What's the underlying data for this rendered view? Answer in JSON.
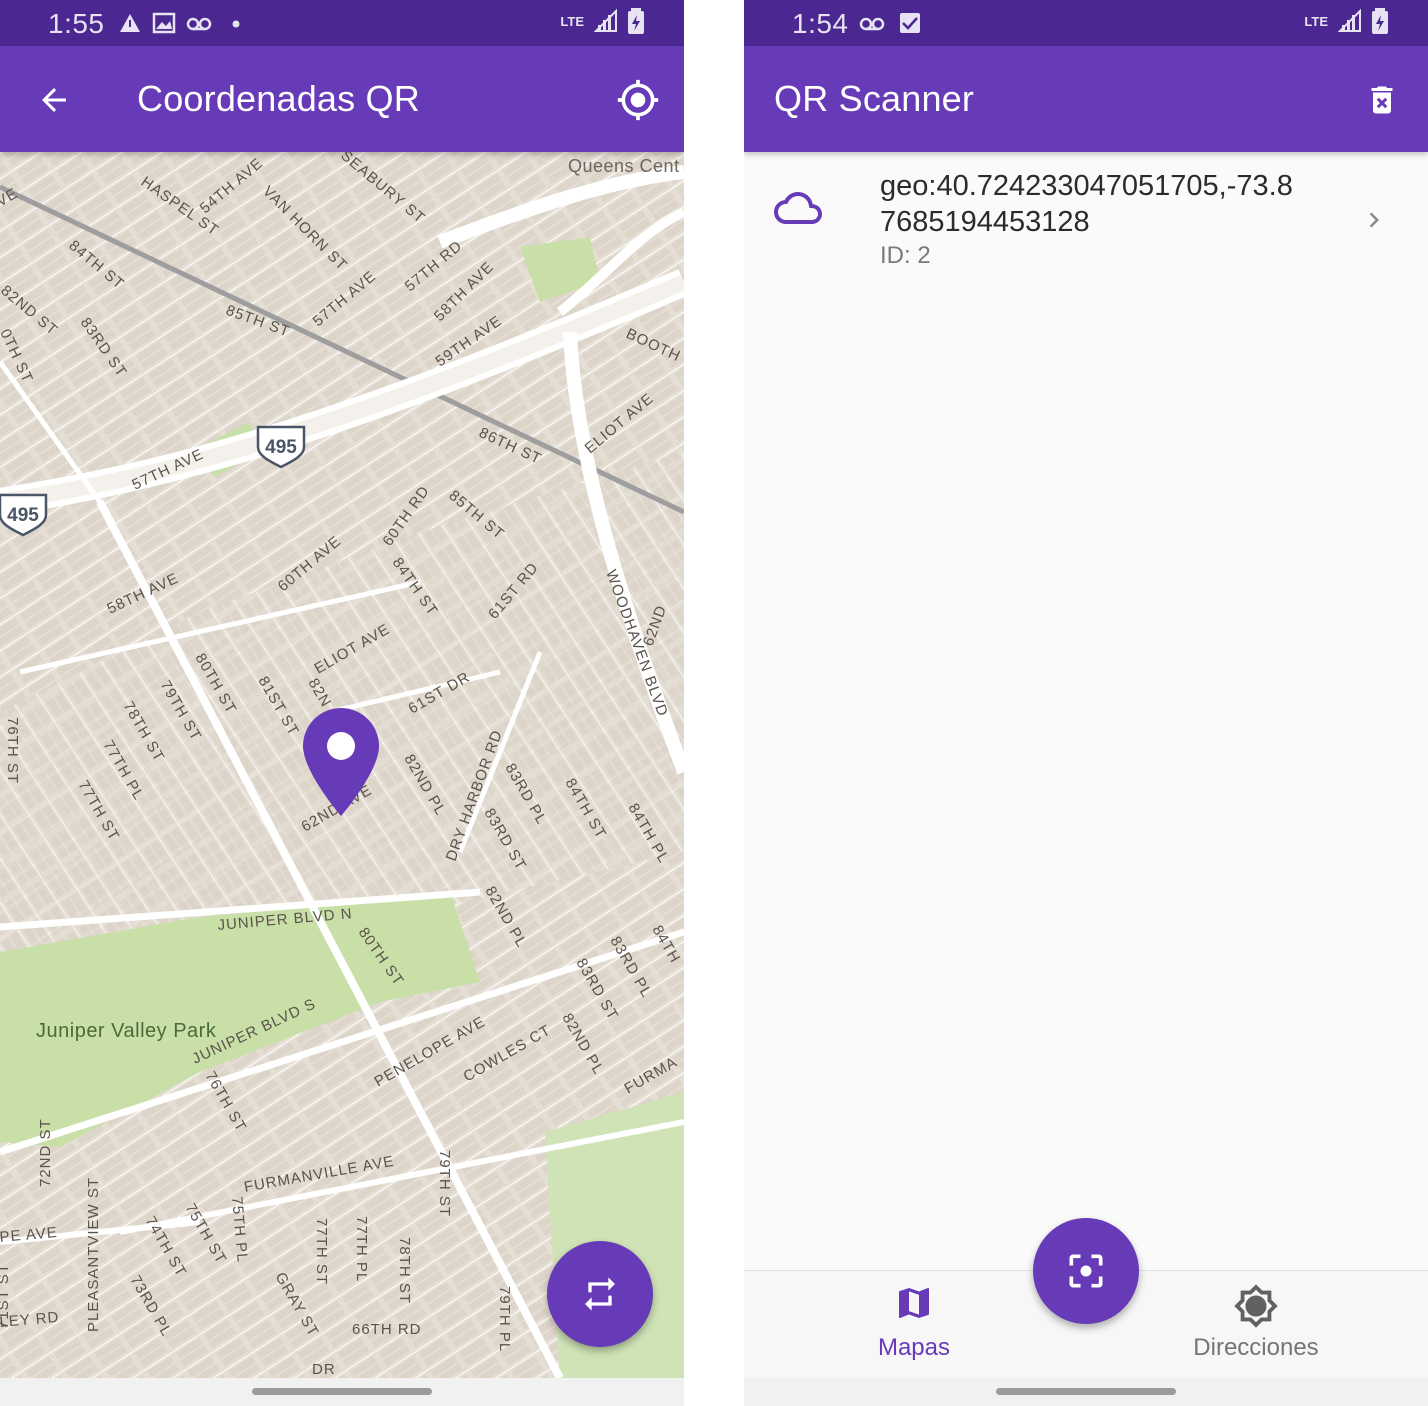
{
  "left_screen": {
    "status_time": "1:55",
    "status_network": "LTE",
    "title": "Coordenadas QR",
    "map": {
      "corner_label": "Queens Cent",
      "highway_shield": "495",
      "park_label": "Juniper Valley Park",
      "streets": [
        "VE",
        "HASPEL ST",
        "54TH AVE",
        "SEABURY ST",
        "VAN HORN ST",
        "84TH ST",
        "57TH AVE",
        "57TH RD",
        "58TH AVE",
        "85TH ST",
        "82ND ST",
        "83RD ST",
        "0TH ST",
        "59TH AVE",
        "BOOTH",
        "ELIOT AVE",
        "86TH ST",
        "57TH AVE",
        "60TH RD",
        "85TH ST",
        "60TH AVE",
        "84TH ST",
        "61ST RD",
        "58TH AVE",
        "WOODHAVEN BLVD",
        "62ND",
        "ELIOT AVE",
        "80TH ST",
        "79TH ST",
        "81ST ST",
        "82N",
        "61ST DR",
        "76TH ST",
        "78TH ST",
        "77TH PL",
        "77TH ST",
        "62ND AVE",
        "82ND PL",
        "DRY HARBOR RD",
        "83RD PL",
        "83RD ST",
        "84TH ST",
        "84TH PL",
        "JUNIPER BLVD N",
        "80TH ST",
        "82ND PL",
        "84TH",
        "83RD PL",
        "83RD ST",
        "JUNIPER BLVD S",
        "PENELOPE AVE",
        "COWLES CT",
        "82ND PL",
        "FURMA",
        "76TH ST",
        "72ND ST",
        "FURMANVILLE AVE",
        "79TH ST",
        "PE AVE",
        "PLEASANTVIEW ST",
        "74TH ST",
        "75TH ST",
        "75TH PL",
        "77TH ST",
        "77TH PL",
        "78TH ST",
        "71ST ST",
        "LEY RD",
        "73RD PL",
        "GRAY ST",
        "66TH RD",
        "79TH PL",
        "DR"
      ]
    }
  },
  "right_screen": {
    "status_time": "1:54",
    "status_network": "LTE",
    "title": "QR Scanner",
    "scan_item": {
      "value_line1": "geo:40.724233047051705,-73.8",
      "value_line2": "7685194453128",
      "id_label": "ID: 2"
    },
    "bottom_nav": {
      "maps_label": "Mapas",
      "directions_label": "Direcciones"
    }
  },
  "colors": {
    "primary": "#673ab7",
    "primary_dark": "#4a2791",
    "map_land": "#e9e3da",
    "map_park": "#c8e0a7",
    "map_road": "#ffffff"
  }
}
